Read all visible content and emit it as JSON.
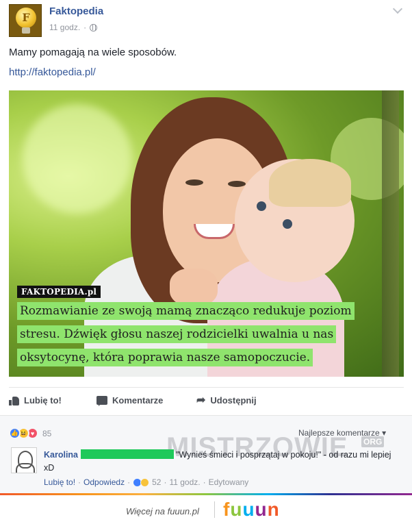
{
  "post": {
    "page_name": "Faktopedia",
    "time": "11 godz.",
    "separator": "·",
    "avatar_letter": "F",
    "text": "Mamy pomagają na wiele sposobów.",
    "link": "http://faktopedia.pl/",
    "image": {
      "logo_text": "FAKTOPEDIA.pl",
      "caption": "Rozmawianie ze swoją mamą znacząco redukuje poziom stresu. Dźwięk głosu naszej rodzicielki uwalnia u nas oksytocynę, która poprawia nasze samopoczucie.",
      "highlight_color": "#8fe46d"
    }
  },
  "actions": {
    "like": "Lubię to!",
    "comment": "Komentarze",
    "share": "Udostępnij"
  },
  "reactions": {
    "count": "85",
    "sort_label": "Najlepsze komentarze",
    "sort_arrow": "▾"
  },
  "watermark": {
    "text": "MISTRZOWIE",
    "suffix": "ORG"
  },
  "comment": {
    "author": "Karolina",
    "text": "\"Wynieś śmieci i posprzątaj w pokoju!\" - od razu mi lepiej xD",
    "like_label": "Lubię to!",
    "reply_label": "Odpowiedz",
    "reaction_count": "52",
    "time": "11 godz.",
    "edited": "Edytowany",
    "dot": "·"
  },
  "footer": {
    "more_text": "Więcej na fuuun.pl",
    "brand_letters": [
      "f",
      "u",
      "u",
      "u",
      "n"
    ]
  },
  "colors": {
    "link_blue": "#365899",
    "like_blue": "#4080ff",
    "haha_yellow": "#f7c33c",
    "love_red": "#f25268",
    "redaction_green": "#1ec95a"
  }
}
